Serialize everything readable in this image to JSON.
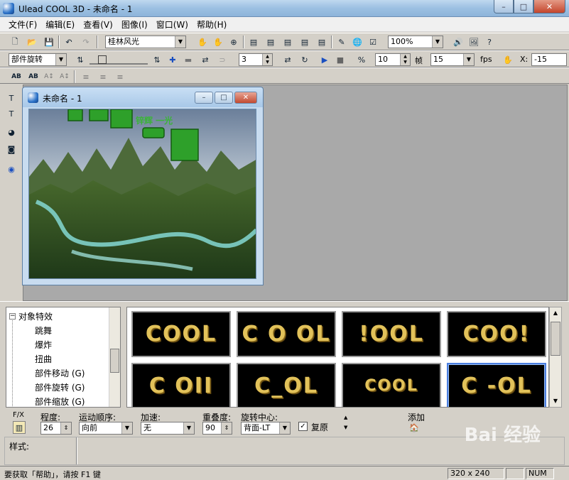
{
  "window": {
    "title": "Ulead COOL 3D - 未命名 - 1",
    "minimize": "–",
    "maximize": "□",
    "close": "✕"
  },
  "menu": [
    "文件(F)",
    "编辑(E)",
    "查看(V)",
    "图像(I)",
    "窗口(W)",
    "帮助(H)"
  ],
  "toolbar1": {
    "bg_preset": "桂林风光",
    "zoom": "100%"
  },
  "toolbar2": {
    "effect_combo": "部件旋转",
    "frame_value": "3",
    "frames_value": "10",
    "frames_label": "帧",
    "fps_value": "15",
    "fps_label": "fps",
    "x_label": "X:",
    "x_value": "-15"
  },
  "document": {
    "title": "未命名 - 1",
    "canvas_text": "锌辉 一光"
  },
  "tree": {
    "root": "对象特效",
    "items": [
      "跳舞",
      "爆炸",
      "扭曲",
      "部件移动 (G)",
      "部件旋转 (G)",
      "部件缩放 (G)"
    ]
  },
  "thumbnails": [
    "COOL",
    "C O OL",
    "!OOL",
    "COO!",
    "C OII",
    "C_OL",
    "COOL",
    "C -OL"
  ],
  "props": {
    "fx_label": "F/X",
    "degree_label": "程度:",
    "degree_value": "26",
    "order_label": "运动顺序:",
    "order_value": "向前",
    "accel_label": "加速:",
    "accel_value": "无",
    "overlap_label": "重叠度:",
    "overlap_value": "90",
    "center_label": "旋转中心:",
    "center_value": "背面-LT",
    "restore_label": "复原",
    "restore_checked": "✓",
    "add_label": "添加"
  },
  "style": {
    "label": "样式:"
  },
  "status": {
    "message": "要获取「帮助」，请按 F1 键",
    "size": "320 x 240",
    "num": "NUM"
  },
  "watermark": "Bai 经验",
  "colors": {
    "accent": "#4a7ee0",
    "gold": "#e2c25a",
    "workspace": "#a9a9a9"
  }
}
